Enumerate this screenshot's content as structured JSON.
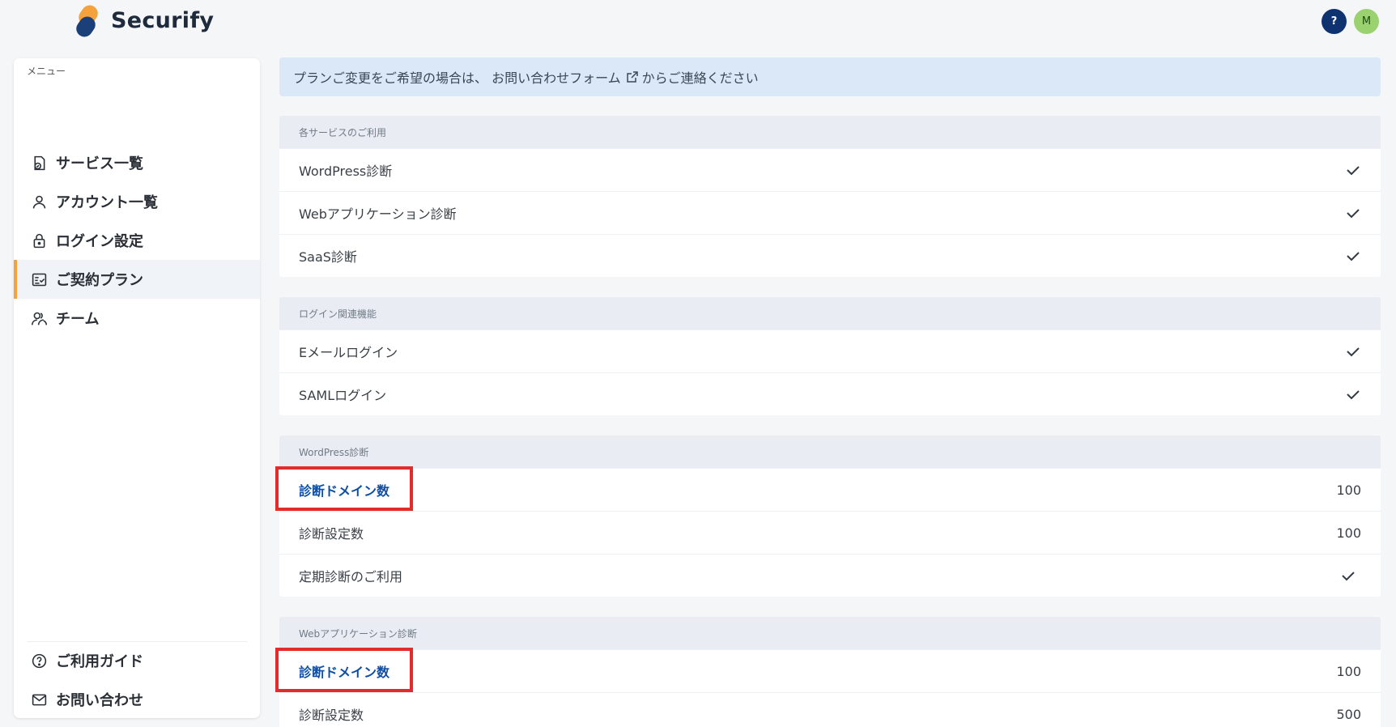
{
  "header": {
    "brand": "Securify",
    "help_label": "?",
    "avatar_initial": "M"
  },
  "sidebar": {
    "menu_title": "メニュー",
    "items": [
      {
        "label": "サービス一覧",
        "icon": "service-list-icon"
      },
      {
        "label": "アカウント一覧",
        "icon": "user-icon"
      },
      {
        "label": "ログイン設定",
        "icon": "lock-icon"
      },
      {
        "label": "ご契約プラン",
        "icon": "plan-icon",
        "active": true
      },
      {
        "label": "チーム",
        "icon": "team-icon"
      }
    ],
    "footer_items": [
      {
        "label": "ご利用ガイド",
        "icon": "question-circle-icon"
      },
      {
        "label": "お問い合わせ",
        "icon": "mail-icon"
      }
    ]
  },
  "notice": {
    "text_before": "プランご変更をご希望の場合は、 お問い合わせフォーム",
    "text_after": "からご連絡ください"
  },
  "sections": [
    {
      "title": "各サービスのご利用",
      "rows": [
        {
          "label": "WordPress診断",
          "value": "check"
        },
        {
          "label": "Webアプリケーション診断",
          "value": "check"
        },
        {
          "label": "SaaS診断",
          "value": "check"
        }
      ]
    },
    {
      "title": "ログイン関連機能",
      "rows": [
        {
          "label": "Eメールログイン",
          "value": "check"
        },
        {
          "label": "SAMLログイン",
          "value": "check"
        }
      ]
    },
    {
      "title": "WordPress診断",
      "rows": [
        {
          "label": "診断ドメイン数",
          "value": "100",
          "highlight": true
        },
        {
          "label": "診断設定数",
          "value": "100"
        },
        {
          "label": "定期診断のご利用",
          "value": "check"
        }
      ]
    },
    {
      "title": "Webアプリケーション診断",
      "rows": [
        {
          "label": "診断ドメイン数",
          "value": "100",
          "highlight": true
        },
        {
          "label": "診断設定数",
          "value": "500"
        }
      ]
    }
  ],
  "colors": {
    "accent": "#f5a23c",
    "primary": "#0f3270",
    "link": "#0f4ea3",
    "highlight_box": "#e22b2b",
    "notice_bg": "#dbe8f8"
  }
}
